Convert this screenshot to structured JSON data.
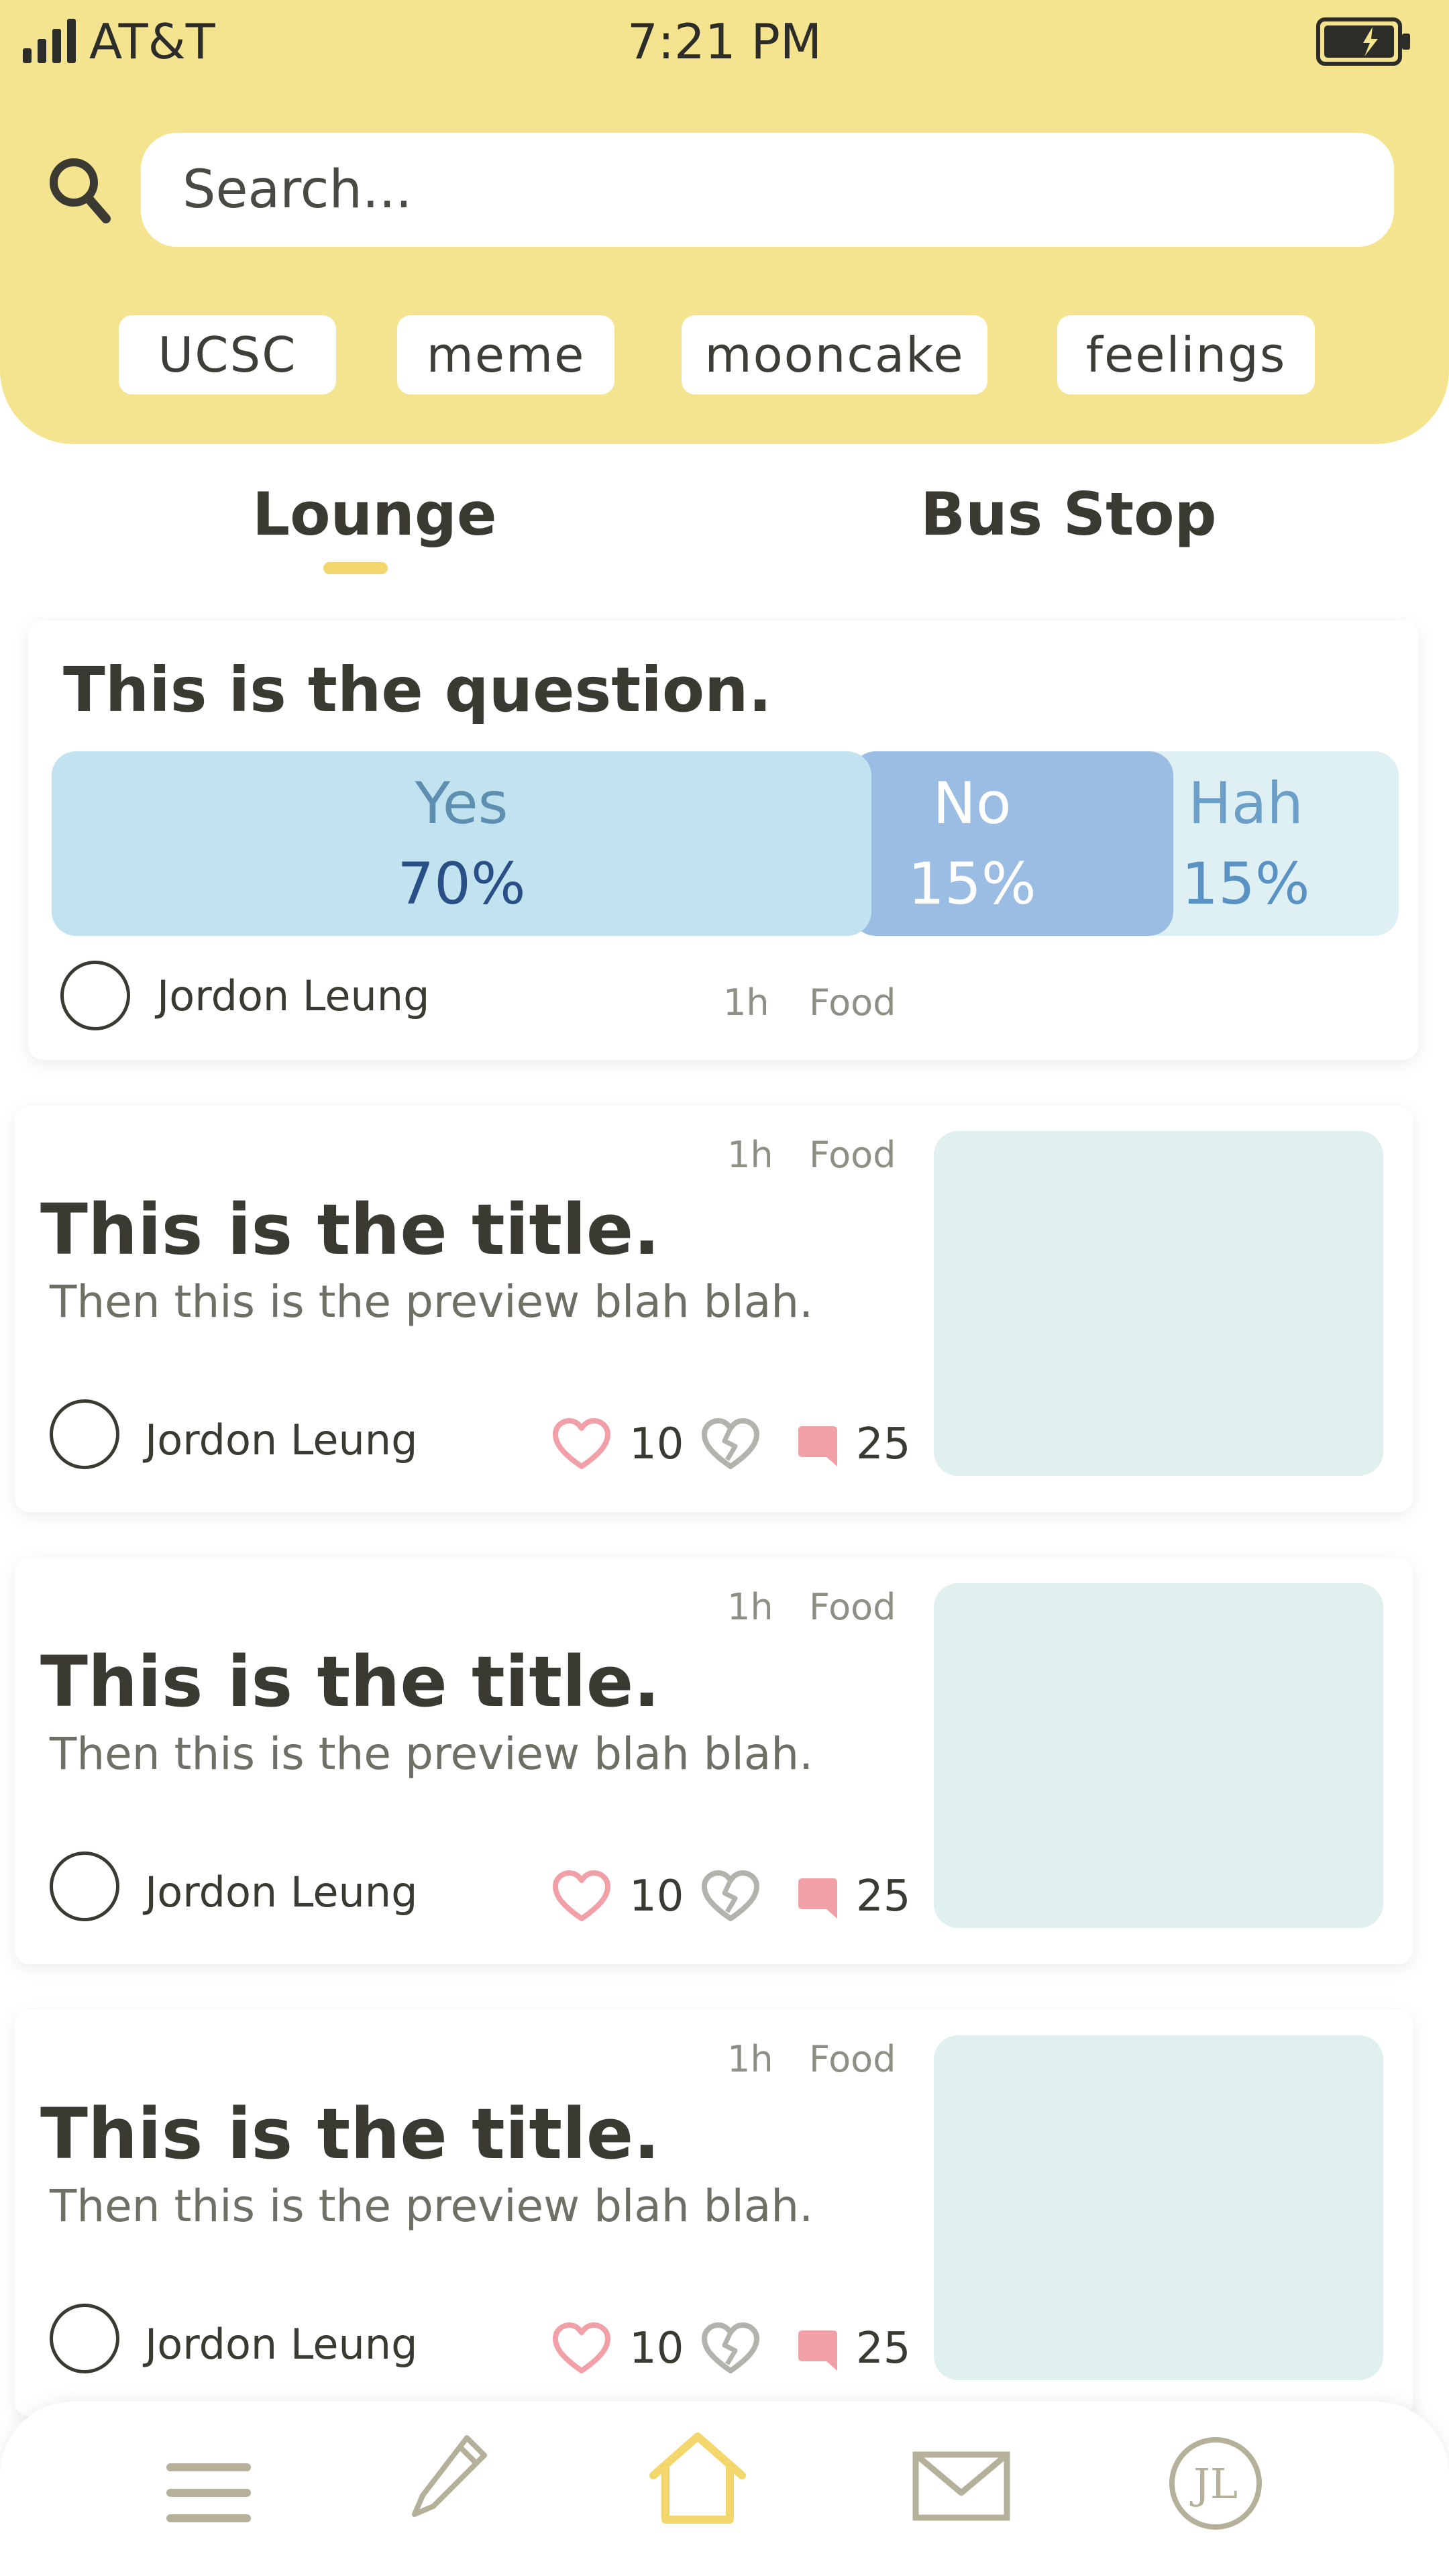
{
  "status_bar": {
    "carrier": "AT&T",
    "time": "7:21 PM"
  },
  "search": {
    "placeholder": "Search..."
  },
  "tags": [
    "UCSC",
    "meme",
    "mooncake",
    "feelings"
  ],
  "tabs": [
    {
      "label": "Lounge",
      "active": true
    },
    {
      "label": "Bus Stop",
      "active": false
    }
  ],
  "poll": {
    "question": "This is the question.",
    "options": [
      {
        "label": "Yes",
        "percent": "70%",
        "value": 70,
        "color": "#c0e3ef"
      },
      {
        "label": "No",
        "percent": "15%",
        "value": 15,
        "color": "#9bbde3"
      },
      {
        "label": "Hah",
        "percent": "15%",
        "value": 15,
        "color": "#dff0f4"
      }
    ],
    "author": "Jordon Leung",
    "time": "1h",
    "category": "Food"
  },
  "posts": [
    {
      "title": "This is the title.",
      "preview": "Then this is the preview blah blah.",
      "author": "Jordon Leung",
      "time": "1h",
      "category": "Food",
      "likes": "10",
      "comments": "25"
    },
    {
      "title": "This is the title.",
      "preview": "Then this is the preview blah blah.",
      "author": "Jordon Leung",
      "time": "1h",
      "category": "Food",
      "likes": "10",
      "comments": "25"
    },
    {
      "title": "This is the title.",
      "preview": "Then this is the preview blah blah.",
      "author": "Jordon Leung",
      "time": "1h",
      "category": "Food",
      "likes": "10",
      "comments": "25"
    }
  ],
  "nav": {
    "items": [
      "menu-icon",
      "pencil-icon",
      "home-icon",
      "mail-icon",
      "profile-icon"
    ],
    "profile_initials": "JL",
    "active": "home-icon"
  },
  "colors": {
    "header": "#f5e48f",
    "accent": "#f3d76d",
    "like": "#f0a0a6",
    "comment": "#f0a0a6",
    "thumb": "#dff0ef",
    "nav_icon": "#b4b09a"
  }
}
